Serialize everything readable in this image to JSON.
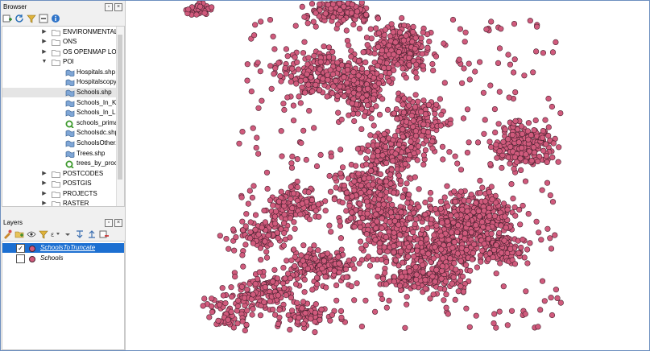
{
  "browser": {
    "title": "Browser",
    "items": [
      {
        "label": "ENVIRONMENTAL",
        "type": "folder",
        "expanded": false
      },
      {
        "label": "ONS",
        "type": "folder",
        "expanded": false
      },
      {
        "label": "OS OPENMAP LOCAL",
        "type": "folder",
        "expanded": false
      },
      {
        "label": "POI",
        "type": "folder",
        "expanded": true
      },
      {
        "label": "Hospitals.shp",
        "type": "shp"
      },
      {
        "label": "Hospitalscopy.shp",
        "type": "shp"
      },
      {
        "label": "Schools.shp",
        "type": "shp",
        "selected": true
      },
      {
        "label": "Schools_In_Kent",
        "type": "shp"
      },
      {
        "label": "Schools_In_Lincs",
        "type": "shp"
      },
      {
        "label": "schools_primary",
        "type": "qgs"
      },
      {
        "label": "Schoolsdc.shp",
        "type": "shp"
      },
      {
        "label": "SchoolsOther.shp",
        "type": "shp"
      },
      {
        "label": "Trees.shp",
        "type": "shp"
      },
      {
        "label": "trees_by_processed",
        "type": "qgs"
      },
      {
        "label": "POSTCODES",
        "type": "folder",
        "expanded": false
      },
      {
        "label": "POSTGIS",
        "type": "folder",
        "expanded": false
      },
      {
        "label": "PROJECTS",
        "type": "folder",
        "expanded": false
      },
      {
        "label": "RASTER",
        "type": "folder",
        "expanded": false
      }
    ]
  },
  "layers": {
    "title": "Layers",
    "items": [
      {
        "label": "SchoolsToTruncate",
        "checked": true,
        "selected": true
      },
      {
        "label": "Schools",
        "checked": false,
        "selected": false
      }
    ]
  },
  "colors": {
    "point_fill": "#d05a7c",
    "point_stroke": "#4a2230",
    "selection": "#1c6fd1",
    "shp_icon": "#7fa6d6",
    "qgs_icon": "#3f9a2f"
  }
}
